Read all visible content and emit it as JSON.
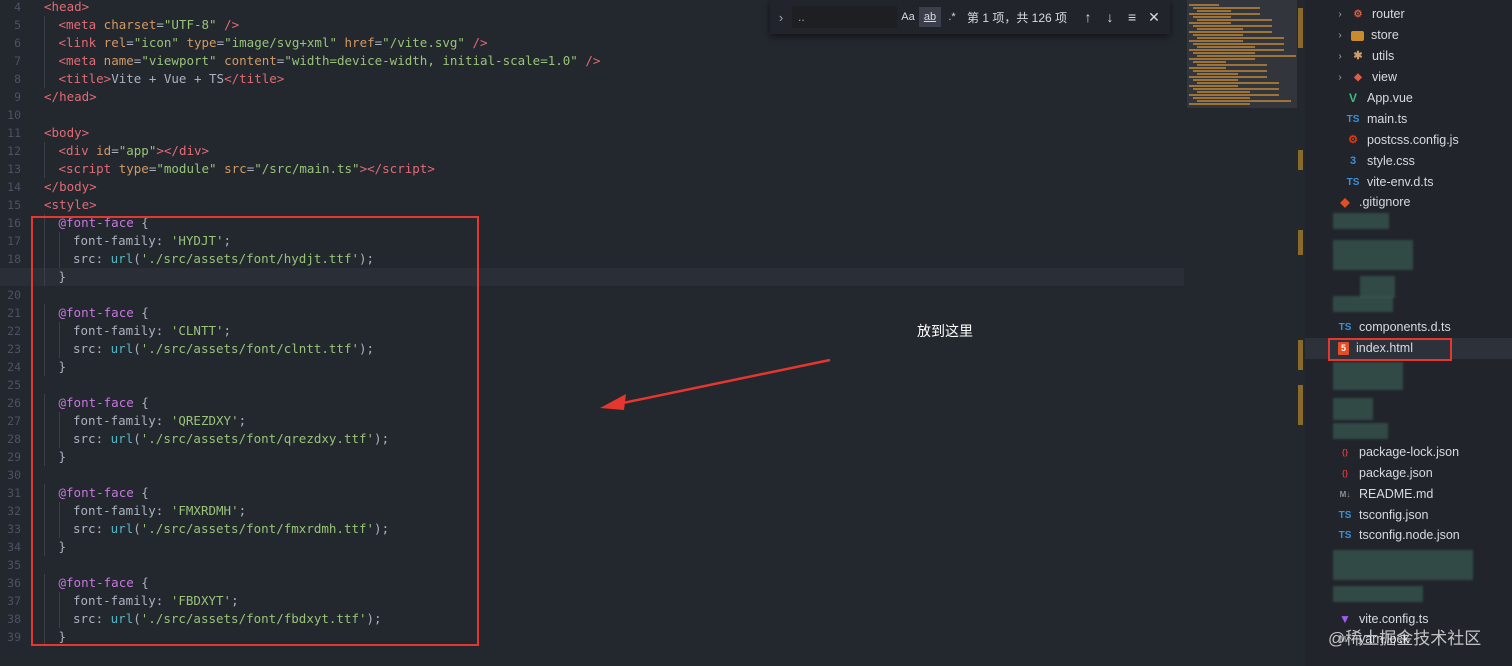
{
  "editor": {
    "line_numbers": [
      "4",
      "5",
      "6",
      "7",
      "8",
      "9",
      "10",
      "11",
      "12",
      "13",
      "14",
      "15",
      "16",
      "17",
      "18",
      "19",
      "20",
      "21",
      "22",
      "23",
      "24",
      "25",
      "26",
      "27",
      "28",
      "29",
      "30",
      "31",
      "32",
      "33",
      "34",
      "35",
      "36",
      "37",
      "38",
      "39"
    ],
    "active_line": "19",
    "lines": [
      {
        "indent": 0,
        "tokens": [
          {
            "t": "<",
            "c": "tag"
          },
          {
            "t": "head",
            "c": "tag"
          },
          {
            "t": ">",
            "c": "tag"
          }
        ]
      },
      {
        "indent": 1,
        "tokens": [
          {
            "t": "<",
            "c": "tag"
          },
          {
            "t": "meta",
            "c": "tag"
          },
          {
            "t": " charset",
            "c": "attr"
          },
          {
            "t": "=",
            "c": "punct"
          },
          {
            "t": "\"UTF-8\"",
            "c": "str"
          },
          {
            "t": " />",
            "c": "tag"
          }
        ]
      },
      {
        "indent": 1,
        "tokens": [
          {
            "t": "<",
            "c": "tag"
          },
          {
            "t": "link",
            "c": "tag"
          },
          {
            "t": " rel",
            "c": "attr"
          },
          {
            "t": "=",
            "c": "punct"
          },
          {
            "t": "\"icon\"",
            "c": "str"
          },
          {
            "t": " type",
            "c": "attr"
          },
          {
            "t": "=",
            "c": "punct"
          },
          {
            "t": "\"image/svg+xml\"",
            "c": "str"
          },
          {
            "t": " href",
            "c": "attr"
          },
          {
            "t": "=",
            "c": "punct"
          },
          {
            "t": "\"/vite.svg\"",
            "c": "str"
          },
          {
            "t": " />",
            "c": "tag"
          }
        ]
      },
      {
        "indent": 1,
        "tokens": [
          {
            "t": "<",
            "c": "tag"
          },
          {
            "t": "meta",
            "c": "tag"
          },
          {
            "t": " name",
            "c": "attr"
          },
          {
            "t": "=",
            "c": "punct"
          },
          {
            "t": "\"viewport\"",
            "c": "str"
          },
          {
            "t": " content",
            "c": "attr"
          },
          {
            "t": "=",
            "c": "punct"
          },
          {
            "t": "\"width=device-width, initial-scale=1.0\"",
            "c": "str"
          },
          {
            "t": " />",
            "c": "tag"
          }
        ]
      },
      {
        "indent": 1,
        "tokens": [
          {
            "t": "<",
            "c": "tag"
          },
          {
            "t": "title",
            "c": "tag"
          },
          {
            "t": ">",
            "c": "tag"
          },
          {
            "t": "Vite + Vue + TS",
            "c": "prop"
          },
          {
            "t": "</",
            "c": "tag"
          },
          {
            "t": "title",
            "c": "tag"
          },
          {
            "t": ">",
            "c": "tag"
          }
        ]
      },
      {
        "indent": 0,
        "tokens": [
          {
            "t": "</",
            "c": "tag"
          },
          {
            "t": "head",
            "c": "tag"
          },
          {
            "t": ">",
            "c": "tag"
          }
        ]
      },
      {
        "indent": 0,
        "tokens": []
      },
      {
        "indent": 0,
        "tokens": [
          {
            "t": "<",
            "c": "tag"
          },
          {
            "t": "body",
            "c": "tag"
          },
          {
            "t": ">",
            "c": "tag"
          }
        ]
      },
      {
        "indent": 1,
        "tokens": [
          {
            "t": "<",
            "c": "tag"
          },
          {
            "t": "div",
            "c": "tag"
          },
          {
            "t": " id",
            "c": "attr"
          },
          {
            "t": "=",
            "c": "punct"
          },
          {
            "t": "\"app\"",
            "c": "str"
          },
          {
            "t": "></",
            "c": "tag"
          },
          {
            "t": "div",
            "c": "tag"
          },
          {
            "t": ">",
            "c": "tag"
          }
        ]
      },
      {
        "indent": 1,
        "tokens": [
          {
            "t": "<",
            "c": "tag"
          },
          {
            "t": "script",
            "c": "tag"
          },
          {
            "t": " type",
            "c": "attr"
          },
          {
            "t": "=",
            "c": "punct"
          },
          {
            "t": "\"module\"",
            "c": "str"
          },
          {
            "t": " src",
            "c": "attr"
          },
          {
            "t": "=",
            "c": "punct"
          },
          {
            "t": "\"/src/main.ts\"",
            "c": "str"
          },
          {
            "t": "></",
            "c": "tag"
          },
          {
            "t": "script",
            "c": "tag"
          },
          {
            "t": ">",
            "c": "tag"
          }
        ]
      },
      {
        "indent": 0,
        "tokens": [
          {
            "t": "</",
            "c": "tag"
          },
          {
            "t": "body",
            "c": "tag"
          },
          {
            "t": ">",
            "c": "tag"
          }
        ]
      },
      {
        "indent": 0,
        "tokens": [
          {
            "t": "<",
            "c": "tag"
          },
          {
            "t": "style",
            "c": "tag"
          },
          {
            "t": ">",
            "c": "tag"
          }
        ]
      },
      {
        "indent": 1,
        "tokens": [
          {
            "t": "@font-face",
            "c": "at"
          },
          {
            "t": " {",
            "c": "punct"
          }
        ]
      },
      {
        "indent": 2,
        "tokens": [
          {
            "t": "font-family",
            "c": "prop"
          },
          {
            "t": ": ",
            "c": "punct"
          },
          {
            "t": "'HYDJT'",
            "c": "str"
          },
          {
            "t": ";",
            "c": "punct"
          }
        ]
      },
      {
        "indent": 2,
        "tokens": [
          {
            "t": "src",
            "c": "prop"
          },
          {
            "t": ": ",
            "c": "punct"
          },
          {
            "t": "url",
            "c": "fn"
          },
          {
            "t": "(",
            "c": "punct"
          },
          {
            "t": "'./src/assets/font/hydjt.ttf'",
            "c": "str"
          },
          {
            "t": ");",
            "c": "punct"
          }
        ]
      },
      {
        "indent": 1,
        "tokens": [
          {
            "t": "}",
            "c": "punct"
          }
        ]
      },
      {
        "indent": 0,
        "tokens": []
      },
      {
        "indent": 1,
        "tokens": [
          {
            "t": "@font-face",
            "c": "at"
          },
          {
            "t": " {",
            "c": "punct"
          }
        ]
      },
      {
        "indent": 2,
        "tokens": [
          {
            "t": "font-family",
            "c": "prop"
          },
          {
            "t": ": ",
            "c": "punct"
          },
          {
            "t": "'CLNTT'",
            "c": "str"
          },
          {
            "t": ";",
            "c": "punct"
          }
        ]
      },
      {
        "indent": 2,
        "tokens": [
          {
            "t": "src",
            "c": "prop"
          },
          {
            "t": ": ",
            "c": "punct"
          },
          {
            "t": "url",
            "c": "fn"
          },
          {
            "t": "(",
            "c": "punct"
          },
          {
            "t": "'./src/assets/font/clntt.ttf'",
            "c": "str"
          },
          {
            "t": ");",
            "c": "punct"
          }
        ]
      },
      {
        "indent": 1,
        "tokens": [
          {
            "t": "}",
            "c": "punct"
          }
        ]
      },
      {
        "indent": 0,
        "tokens": []
      },
      {
        "indent": 1,
        "tokens": [
          {
            "t": "@font-face",
            "c": "at"
          },
          {
            "t": " {",
            "c": "punct"
          }
        ]
      },
      {
        "indent": 2,
        "tokens": [
          {
            "t": "font-family",
            "c": "prop"
          },
          {
            "t": ": ",
            "c": "punct"
          },
          {
            "t": "'QREZDXY'",
            "c": "str"
          },
          {
            "t": ";",
            "c": "punct"
          }
        ]
      },
      {
        "indent": 2,
        "tokens": [
          {
            "t": "src",
            "c": "prop"
          },
          {
            "t": ": ",
            "c": "punct"
          },
          {
            "t": "url",
            "c": "fn"
          },
          {
            "t": "(",
            "c": "punct"
          },
          {
            "t": "'./src/assets/font/qrezdxy.ttf'",
            "c": "str"
          },
          {
            "t": ");",
            "c": "punct"
          }
        ]
      },
      {
        "indent": 1,
        "tokens": [
          {
            "t": "}",
            "c": "punct"
          }
        ]
      },
      {
        "indent": 0,
        "tokens": []
      },
      {
        "indent": 1,
        "tokens": [
          {
            "t": "@font-face",
            "c": "at"
          },
          {
            "t": " {",
            "c": "punct"
          }
        ]
      },
      {
        "indent": 2,
        "tokens": [
          {
            "t": "font-family",
            "c": "prop"
          },
          {
            "t": ": ",
            "c": "punct"
          },
          {
            "t": "'FMXRDMH'",
            "c": "str"
          },
          {
            "t": ";",
            "c": "punct"
          }
        ]
      },
      {
        "indent": 2,
        "tokens": [
          {
            "t": "src",
            "c": "prop"
          },
          {
            "t": ": ",
            "c": "punct"
          },
          {
            "t": "url",
            "c": "fn"
          },
          {
            "t": "(",
            "c": "punct"
          },
          {
            "t": "'./src/assets/font/fmxrdmh.ttf'",
            "c": "str"
          },
          {
            "t": ");",
            "c": "punct"
          }
        ]
      },
      {
        "indent": 1,
        "tokens": [
          {
            "t": "}",
            "c": "punct"
          }
        ]
      },
      {
        "indent": 0,
        "tokens": []
      },
      {
        "indent": 1,
        "tokens": [
          {
            "t": "@font-face",
            "c": "at"
          },
          {
            "t": " {",
            "c": "punct"
          }
        ]
      },
      {
        "indent": 2,
        "tokens": [
          {
            "t": "font-family",
            "c": "prop"
          },
          {
            "t": ": ",
            "c": "punct"
          },
          {
            "t": "'FBDXYT'",
            "c": "str"
          },
          {
            "t": ";",
            "c": "punct"
          }
        ]
      },
      {
        "indent": 2,
        "tokens": [
          {
            "t": "src",
            "c": "prop"
          },
          {
            "t": ": ",
            "c": "punct"
          },
          {
            "t": "url",
            "c": "fn"
          },
          {
            "t": "(",
            "c": "punct"
          },
          {
            "t": "'./src/assets/font/fbdxyt.ttf'",
            "c": "str"
          },
          {
            "t": ");",
            "c": "punct"
          }
        ]
      },
      {
        "indent": 1,
        "tokens": [
          {
            "t": "}",
            "c": "punct"
          }
        ]
      }
    ]
  },
  "find_widget": {
    "query": "..",
    "match_case": "Aa",
    "whole_word": "ab",
    "regex": ".*",
    "result": "第 1 项，共 126 项",
    "prev": "↑",
    "next": "↓",
    "in_selection": "≡",
    "close": "✕",
    "expand": "›"
  },
  "annotation": {
    "text": "放到这里",
    "color": "#e5362f"
  },
  "explorer": {
    "items": [
      {
        "label": "router",
        "icon": "router",
        "chevron": "›"
      },
      {
        "label": "store",
        "icon": "folder",
        "chevron": "›"
      },
      {
        "label": "utils",
        "icon": "utils",
        "chevron": "›"
      },
      {
        "label": "view",
        "icon": "view",
        "chevron": "›"
      },
      {
        "label": "App.vue",
        "icon": "vue",
        "chevron": ""
      },
      {
        "label": "main.ts",
        "icon": "ts",
        "chevron": ""
      },
      {
        "label": "postcss.config.js",
        "icon": "postcss",
        "chevron": ""
      },
      {
        "label": "style.css",
        "icon": "css",
        "chevron": ""
      },
      {
        "label": "vite-env.d.ts",
        "icon": "ts",
        "chevron": ""
      },
      {
        "label": ".gitignore",
        "icon": "git",
        "chevron": ""
      },
      {
        "label": "components.d.ts",
        "icon": "ts",
        "chevron": ""
      },
      {
        "label": "index.html",
        "icon": "html",
        "chevron": ""
      },
      {
        "label": "package-lock.json",
        "icon": "json",
        "chevron": ""
      },
      {
        "label": "package.json",
        "icon": "json",
        "chevron": ""
      },
      {
        "label": "README.md",
        "icon": "md",
        "chevron": ""
      },
      {
        "label": "tsconfig.json",
        "icon": "tsconfig",
        "chevron": ""
      },
      {
        "label": "tsconfig.node.json",
        "icon": "tsconfig",
        "chevron": ""
      },
      {
        "label": "vite.config.ts",
        "icon": "vite",
        "chevron": ""
      },
      {
        "label": "yarn.lock",
        "icon": "md",
        "chevron": ""
      }
    ],
    "selected": "index.html"
  },
  "watermark": "@稀土掘金技术社区",
  "icon_glyphs": {
    "router": "⚙",
    "folder": "",
    "utils": "✱",
    "view": "◆",
    "vue": "V",
    "ts": "TS",
    "postcss": "⚙",
    "css": "3",
    "git": "◆",
    "html": "5",
    "json": "{}",
    "md": "M↓",
    "tsconfig": "TS",
    "vite": "▼"
  }
}
